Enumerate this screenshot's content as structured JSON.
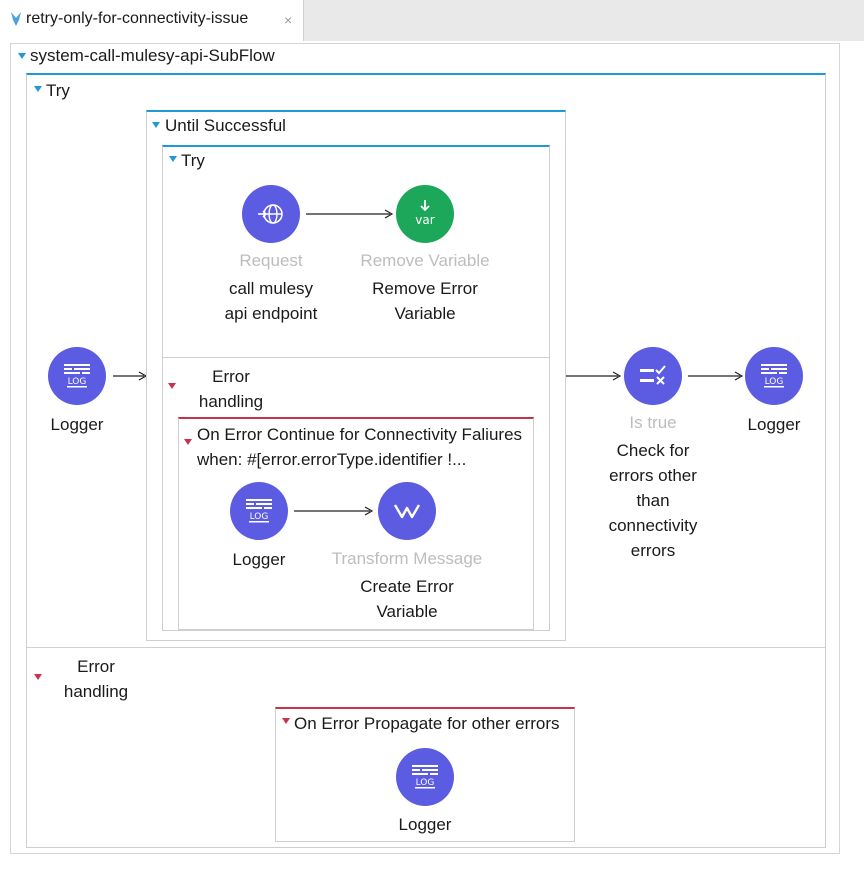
{
  "tab": {
    "title": "retry-only-for-connectivity-issue",
    "close": "×"
  },
  "flow": {
    "title": "system-call-mulesy-api-SubFlow"
  },
  "outer_try": {
    "label": "Try"
  },
  "until_successful": {
    "label": "Until Successful"
  },
  "inner_try": {
    "label": "Try",
    "request": {
      "type": "Request",
      "name": "call mulesy api endpoint"
    },
    "remove_var": {
      "type": "Remove Variable",
      "name": "Remove Error Variable",
      "icon_text": "var"
    }
  },
  "inner_error_handling": {
    "label": "Error handling",
    "on_error_continue": {
      "title": "On Error Continue for Connectivity Faliures",
      "when": "when: #[error.errorType.identifier !...",
      "logger": {
        "name": "Logger",
        "icon_text": "LOG"
      },
      "transform": {
        "type": "Transform Message",
        "name": "Create Error Variable"
      }
    }
  },
  "logger_start": {
    "name": "Logger",
    "icon_text": "LOG"
  },
  "choice": {
    "type": "Is true",
    "name": "Check for errors other than connectivity errors"
  },
  "logger_end": {
    "name": "Logger",
    "icon_text": "LOG"
  },
  "outer_error_handling": {
    "label": "Error handling",
    "on_error_propagate": {
      "title": "On Error Propagate for other errors",
      "logger": {
        "name": "Logger",
        "icon_text": "LOG"
      }
    }
  },
  "colors": {
    "accent_blue": "#1e9bd7",
    "error_red": "#c4344d",
    "node_purple": "#5b5ce2",
    "node_green": "#1ca75a"
  }
}
